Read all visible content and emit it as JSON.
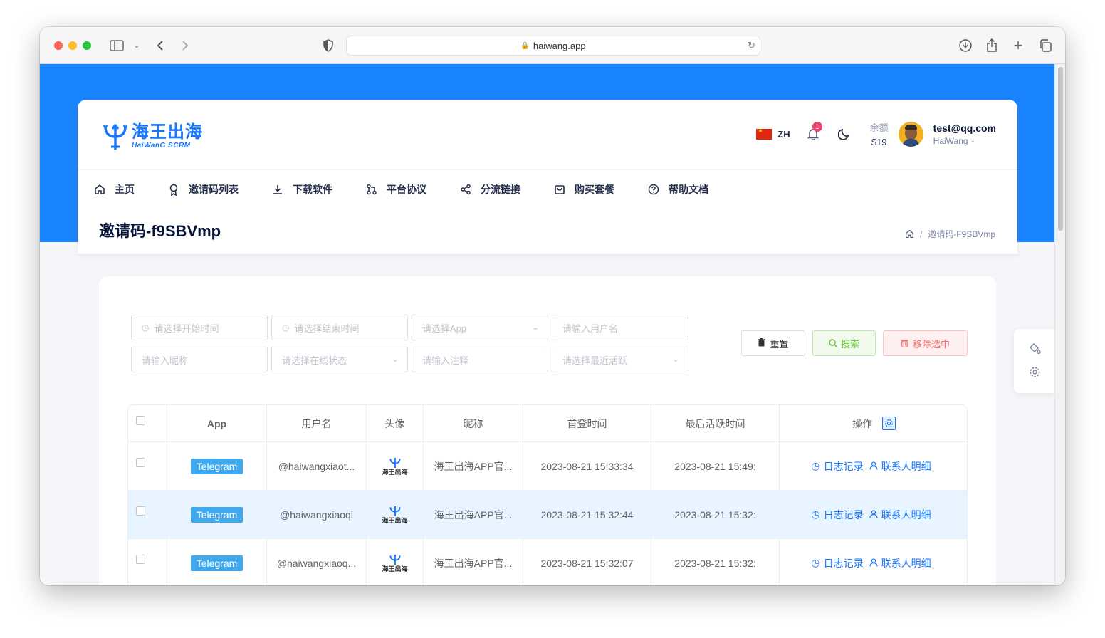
{
  "browser": {
    "url": "haiwang.app"
  },
  "header": {
    "logo_cn": "海王出海",
    "logo_en": "HaiWanG SCRM",
    "lang": "ZH",
    "notif_count": "1",
    "balance_label": "余额",
    "balance_value": "$19",
    "user_email": "test@qq.com",
    "user_name": "HaiWang"
  },
  "nav": [
    {
      "label": "主页",
      "icon": "home-icon"
    },
    {
      "label": "邀请码列表",
      "icon": "award-icon"
    },
    {
      "label": "下载软件",
      "icon": "download-icon"
    },
    {
      "label": "平台协议",
      "icon": "git-icon"
    },
    {
      "label": "分流链接",
      "icon": "share-icon"
    },
    {
      "label": "购买套餐",
      "icon": "bag-icon"
    },
    {
      "label": "帮助文档",
      "icon": "help-icon"
    }
  ],
  "page": {
    "title": "邀请码-f9SBVmp",
    "breadcrumb": "邀请码-F9SBVmp"
  },
  "filters": {
    "start_time": "请选择开始时间",
    "end_time": "请选择结束时间",
    "app": "请选择App",
    "username": "请输入用户名",
    "nickname": "请输入昵称",
    "online_status": "请选择在线状态",
    "note": "请输入注释",
    "recent_active": "请选择最近活跃"
  },
  "buttons": {
    "reset": "重置",
    "search": "搜索",
    "remove": "移除选中"
  },
  "table": {
    "headers": {
      "app": "App",
      "username": "用户名",
      "avatar": "头像",
      "nickname": "昵称",
      "first_login": "首登时间",
      "last_active": "最后活跃时间",
      "actions": "操作"
    },
    "rows": [
      {
        "app": "Telegram",
        "username": "@haiwangxiaot...",
        "avatar": "海王出海",
        "nickname": "海王出海APP官...",
        "first_login": "2023-08-21 15:33:34",
        "last_active": "2023-08-21 15:49:",
        "log": "日志记录",
        "contacts": "联系人明细"
      },
      {
        "app": "Telegram",
        "username": "@haiwangxiaoqi",
        "avatar": "海王出海",
        "nickname": "海王出海APP官...",
        "first_login": "2023-08-21 15:32:44",
        "last_active": "2023-08-21 15:32:",
        "log": "日志记录",
        "contacts": "联系人明细"
      },
      {
        "app": "Telegram",
        "username": "@haiwangxiaoq...",
        "avatar": "海王出海",
        "nickname": "海王出海APP官...",
        "first_login": "2023-08-21 15:32:07",
        "last_active": "2023-08-21 15:32:",
        "log": "日志记录",
        "contacts": "联系人明细"
      }
    ]
  },
  "colors": {
    "primary": "#1677ff",
    "banner": "#1b84ff",
    "tag": "#40a9ee",
    "success": "#67c23a",
    "danger": "#f56c6c"
  }
}
